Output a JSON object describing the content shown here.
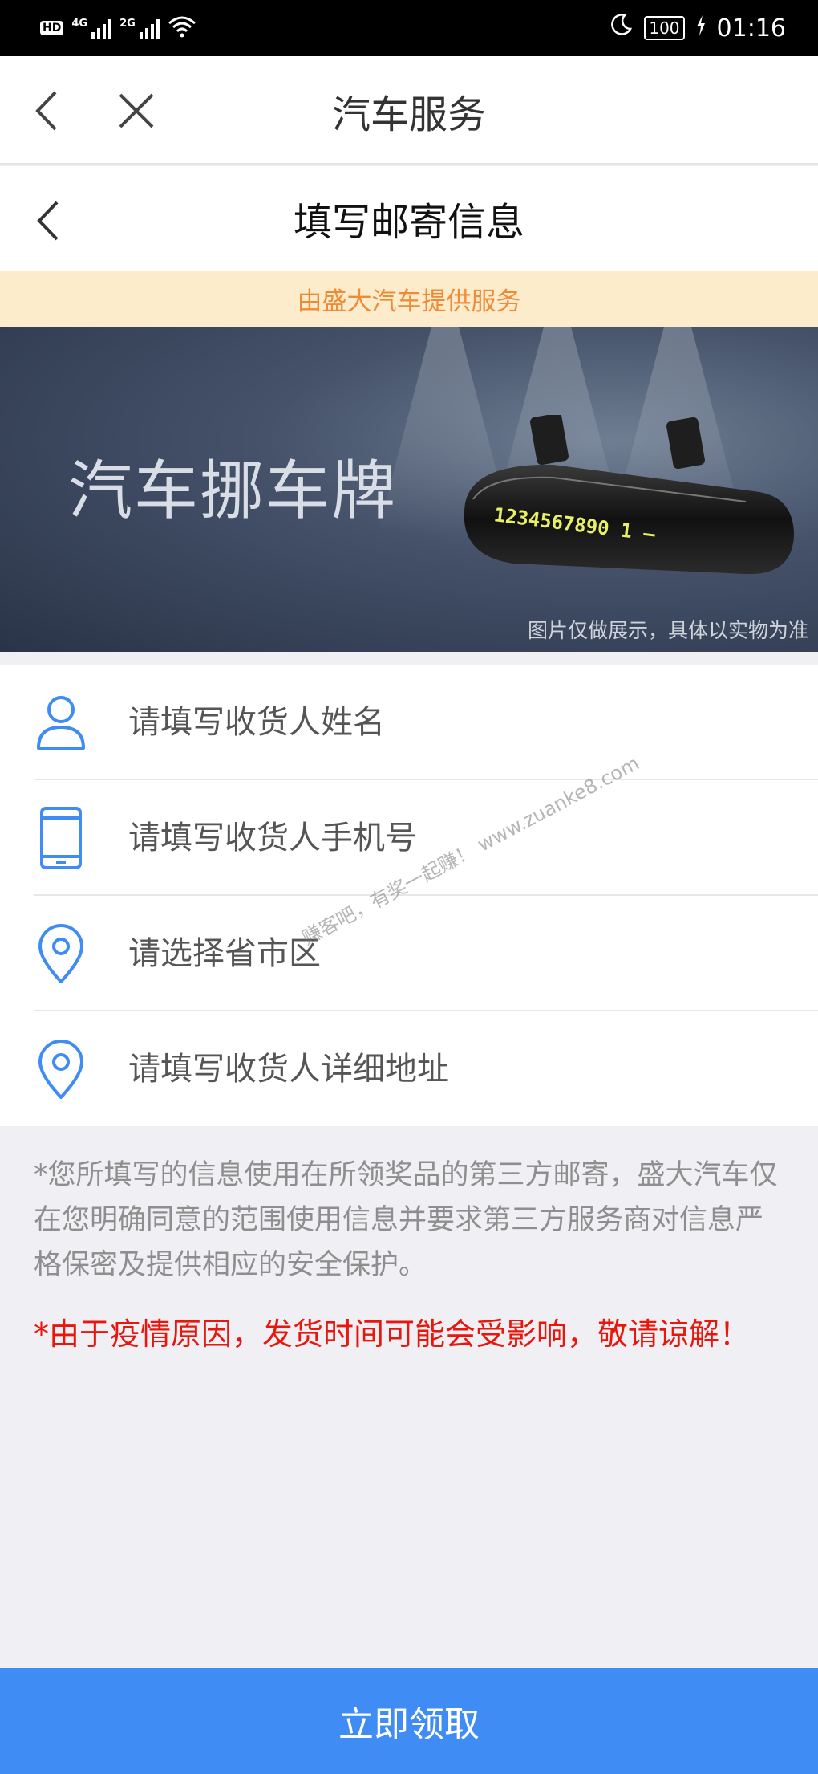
{
  "status_bar": {
    "hd": "HD",
    "network1": "4G",
    "network2": "2G",
    "battery": "100",
    "time": "01:16"
  },
  "header": {
    "title": "汽车服务",
    "back_icon": "chevron-left-icon",
    "close_icon": "close-icon"
  },
  "page": {
    "title": "填写邮寄信息",
    "back_icon": "chevron-left-icon"
  },
  "notice": "由盛大汽车提供服务",
  "banner": {
    "title": "汽车挪车牌",
    "plate_digits": "1234567890 1 —",
    "caption": "图片仅做展示，具体以实物为准"
  },
  "form": {
    "name": {
      "placeholder": "请填写收货人姓名",
      "icon": "person-icon"
    },
    "phone": {
      "placeholder": "请填写收货人手机号",
      "icon": "phone-icon"
    },
    "region": {
      "placeholder": "请选择省市区",
      "icon": "location-pin-icon"
    },
    "address": {
      "placeholder": "请填写收货人详细地址",
      "icon": "location-pin-icon"
    }
  },
  "disclaimer": "*您所填写的信息使用在所领奖品的第三方邮寄，盛大汽车仅在您明确同意的范围使用信息并要求第三方服务商对信息严格保密及提供相应的安全保护。",
  "warning": "*由于疫情原因，发货时间可能会受影响，敬请谅解！",
  "submit_label": "立即领取",
  "watermark": "赚客吧，有奖一起赚！ www.zuanke8.com",
  "colors": {
    "accent": "#3f8cf5",
    "notice_bg": "#fdeccc",
    "notice_text": "#f08a34",
    "warning": "#e8160c",
    "icon_blue": "#3f8cf5"
  }
}
